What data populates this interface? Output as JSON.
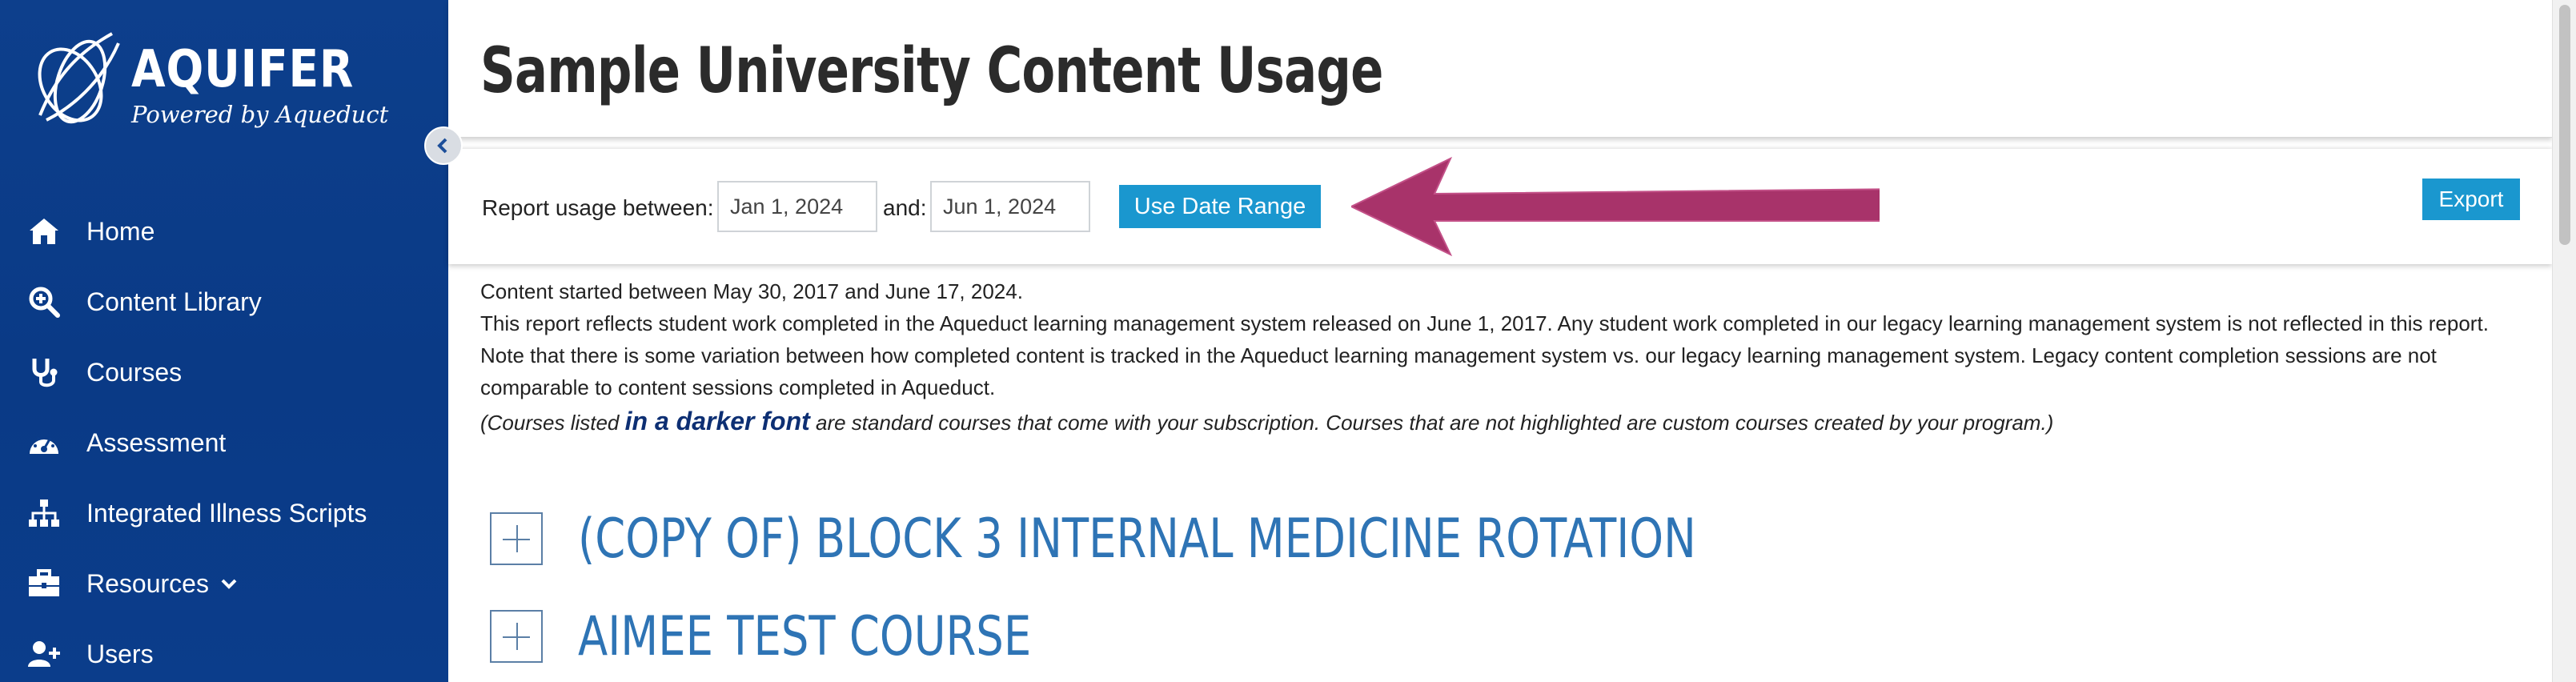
{
  "sidebar": {
    "logo_title": "AQUIFER",
    "logo_subtitle": "Powered by Aqueduct",
    "items": [
      {
        "label": "Home",
        "icon": "home-icon"
      },
      {
        "label": "Content Library",
        "icon": "search-plus-icon"
      },
      {
        "label": "Courses",
        "icon": "stethoscope-icon"
      },
      {
        "label": "Assessment",
        "icon": "gauge-icon"
      },
      {
        "label": "Integrated Illness Scripts",
        "icon": "sitemap-icon"
      },
      {
        "label": "Resources",
        "icon": "briefcase-icon"
      },
      {
        "label": "Users",
        "icon": "user-plus-icon"
      }
    ]
  },
  "header": {
    "title": "Sample University Content Usage"
  },
  "controls": {
    "report_label": "Report usage between:",
    "start_date": "Jan 1, 2024",
    "and_label": "and:",
    "end_date": "Jun 1, 2024",
    "apply_label": "Use Date Range",
    "export_label": "Export"
  },
  "info": {
    "line1": "Content started between May 30, 2017 and June 17, 2024.",
    "line2": "This report reflects student work completed in the Aqueduct learning management system released on June 1, 2017. Any student work completed in our legacy learning management system is not reflected in this report.",
    "line3": "Note that there is some variation between how completed content is tracked in the Aqueduct learning management system vs. our legacy learning management system. Legacy content completion sessions are not comparable to content sessions completed in Aqueduct.",
    "italic_prefix": "(Courses listed ",
    "italic_highlight": "in a darker font",
    "italic_suffix": " are standard courses that come with your subscription. Courses that are not highlighted are custom courses created by your program.)"
  },
  "courses": [
    {
      "name": "(COPY OF) BLOCK 3 INTERNAL MEDICINE ROTATION"
    },
    {
      "name": "AIMEE TEST COURSE"
    }
  ],
  "colors": {
    "sidebar_bg": "#0b3d8b",
    "accent_button": "#1a97cf",
    "course_link": "#2e74b5",
    "annotation_arrow": "#a8336a"
  }
}
